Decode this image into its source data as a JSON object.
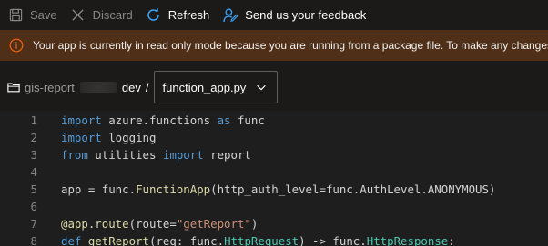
{
  "toolbar": {
    "save_label": "Save",
    "discard_label": "Discard",
    "refresh_label": "Refresh",
    "feedback_label": "Send us your feedback"
  },
  "banner": {
    "icon": "info-icon",
    "text": "Your app is currently in read only mode because you are running from a package file. To make any changes"
  },
  "breadcrumb": {
    "root_label": "gis-report",
    "folder_label": "dev",
    "separator": "/",
    "file_selected": "function_app.py"
  },
  "editor": {
    "lines": [
      {
        "num": "1",
        "text": "import azure.functions as func"
      },
      {
        "num": "2",
        "text": "import logging"
      },
      {
        "num": "3",
        "text": "from utilities import report"
      },
      {
        "num": "4",
        "text": ""
      },
      {
        "num": "5",
        "text": "app = func.FunctionApp(http_auth_level=func.AuthLevel.ANONYMOUS)"
      },
      {
        "num": "6",
        "text": ""
      },
      {
        "num": "7",
        "text": "@app.route(route=\"getReport\")"
      },
      {
        "num": "8",
        "text": "def getReport(req: func.HttpRequest) -> func.HttpResponse:"
      }
    ]
  },
  "colors": {
    "background": "#1b1a19",
    "banner_bg": "#4f2f17",
    "accent": "#0078d4",
    "warning_icon": "#f7630c",
    "editor_bg": "#1e1e1e",
    "keyword": "#569cd6",
    "string": "#ce9178",
    "function": "#dcdcaa",
    "type": "#4ec9b0"
  }
}
